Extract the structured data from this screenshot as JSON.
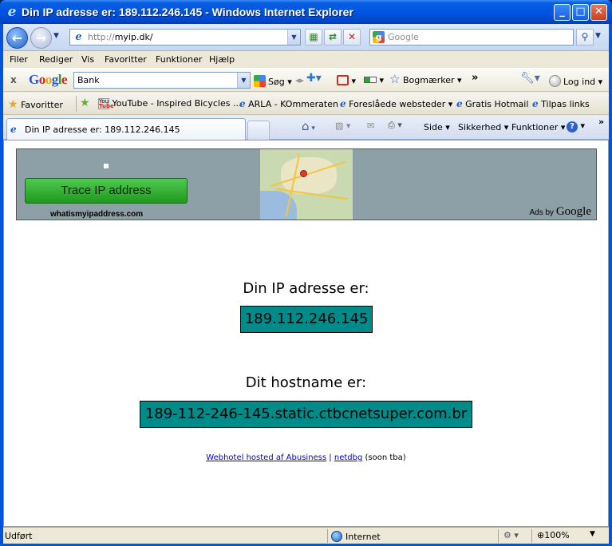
{
  "window": {
    "title": "Din IP adresse er: 189.112.246.145 - Windows Internet Explorer",
    "minimize": "_",
    "maximize": "□",
    "close": "✕"
  },
  "address_bar": {
    "url_protocol": "http://",
    "url_host": "myip.dk/",
    "search_placeholder": "Google"
  },
  "menu": {
    "items": [
      "Filer",
      "Rediger",
      "Vis",
      "Favoritter",
      "Funktioner",
      "Hjælp"
    ]
  },
  "google_toolbar": {
    "close": "x",
    "logo": [
      "G",
      "o",
      "o",
      "g",
      "l",
      "e"
    ],
    "search_value": "Bank",
    "search_button": "Søg",
    "bookmarks": "Bogmærker",
    "more": "»",
    "signin": "Log ind"
  },
  "favorites_bar": {
    "favorites_label": "Favoritter",
    "links": [
      "YouTube - Inspired Bicycles ...",
      "ARLA - KOmmeraten",
      "Foreslåede websteder",
      "Gratis Hotmail",
      "Tilpas links"
    ]
  },
  "tabs": {
    "active_label": "Din IP adresse er: 189.112.246.145"
  },
  "command_bar": {
    "side": "Side",
    "security": "Sikkerhed",
    "tools": "Funktioner",
    "more": "»"
  },
  "ad": {
    "button": "Trace IP address",
    "site": "whatismyipaddress.com",
    "ads_by": "Ads by",
    "google": "Google"
  },
  "page": {
    "ip_label": "Din IP adresse er:",
    "ip_value": "189.112.246.145",
    "host_label": "Dit hostname er:",
    "host_value": "189-112-246-145.static.ctbcnetsuper.com.br",
    "footer_link1": "Webhotel hosted af Abusiness",
    "footer_sep": "|",
    "footer_link2": "netdbg",
    "footer_note": "(soon tba)"
  },
  "status_bar": {
    "status": "Udført",
    "zone": "Internet",
    "zoom": "100%"
  },
  "colors": {
    "ip_box_bg": "#008b8b",
    "titlebar": "#0054e3",
    "trace_button": "#2aa82a"
  }
}
